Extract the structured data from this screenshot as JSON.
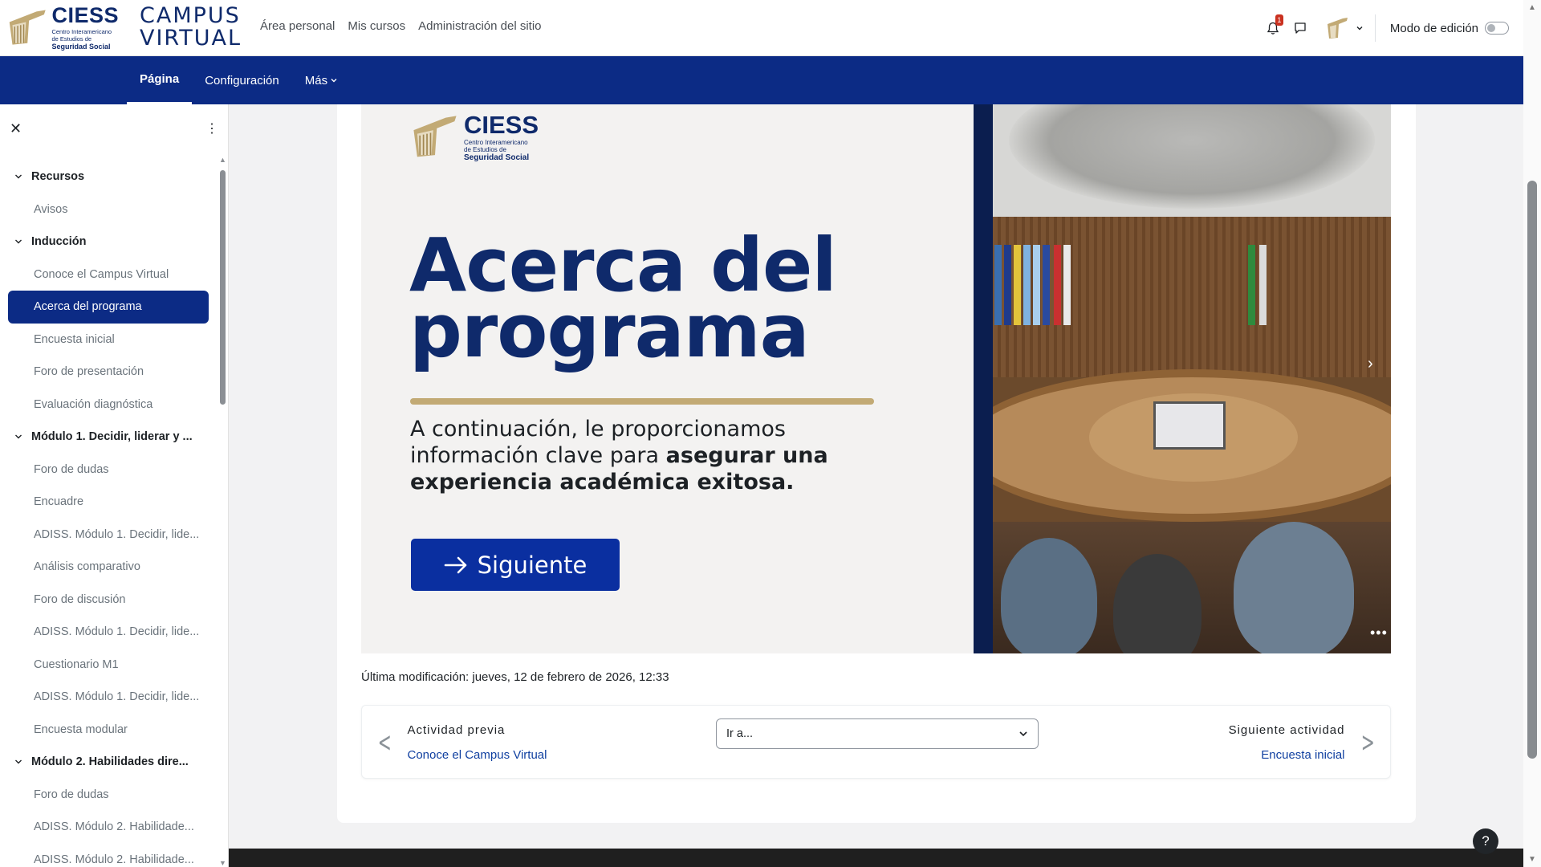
{
  "header": {
    "logo": {
      "name": "CIESS",
      "line1": "Centro Interamericano",
      "line2": "de Estudios de",
      "line3": "Seguridad Social"
    },
    "campus_line1": "CAMPUS",
    "campus_line2": "VIRTUAL",
    "nav": [
      "Área personal",
      "Mis cursos",
      "Administración del sitio"
    ],
    "notification_count": "1",
    "edit_mode_label": "Modo de edición",
    "edit_mode_on": false
  },
  "secondary_nav": {
    "tabs": [
      "Página",
      "Configuración",
      "Más"
    ],
    "active": "Página"
  },
  "drawer": {
    "items": [
      {
        "type": "section",
        "label": "Recursos"
      },
      {
        "type": "item",
        "label": "Avisos"
      },
      {
        "type": "section",
        "label": "Inducción"
      },
      {
        "type": "item",
        "label": "Conoce el Campus Virtual"
      },
      {
        "type": "item",
        "label": "Acerca del programa",
        "active": true
      },
      {
        "type": "item",
        "label": "Encuesta inicial"
      },
      {
        "type": "item",
        "label": "Foro de presentación"
      },
      {
        "type": "item",
        "label": "Evaluación diagnóstica"
      },
      {
        "type": "section",
        "label": "Módulo 1. Decidir, liderar y ..."
      },
      {
        "type": "item",
        "label": "Foro de dudas"
      },
      {
        "type": "item",
        "label": "Encuadre"
      },
      {
        "type": "item",
        "label": "ADISS. Módulo 1. Decidir, lide..."
      },
      {
        "type": "item",
        "label": "Análisis comparativo"
      },
      {
        "type": "item",
        "label": "Foro de discusión"
      },
      {
        "type": "item",
        "label": "ADISS. Módulo 1. Decidir, lide..."
      },
      {
        "type": "item",
        "label": "Cuestionario M1"
      },
      {
        "type": "item",
        "label": "ADISS. Módulo 1. Decidir, lide..."
      },
      {
        "type": "item",
        "label": "Encuesta modular"
      },
      {
        "type": "section",
        "label": "Módulo 2. Habilidades dire..."
      },
      {
        "type": "item",
        "label": "Foro de dudas"
      },
      {
        "type": "item",
        "label": "ADISS. Módulo 2. Habilidade..."
      },
      {
        "type": "item",
        "label": "ADISS. Módulo 2. Habilidade..."
      }
    ]
  },
  "banner": {
    "logo": {
      "name": "CIESS",
      "line1": "Centro Interamericano",
      "line2": "de Estudios de",
      "line3": "Seguridad Social"
    },
    "title_line1": "Acerca del",
    "title_line2": "programa",
    "text_part1": "A continuación, le proporcionamos información clave para ",
    "text_bold": "asegurar una experiencia académica exitosa.",
    "button_label": "Siguiente"
  },
  "modified": "Última modificación: jueves, 12 de febrero de 2026, 12:33",
  "activity_nav": {
    "prev_label": "Actividad previa",
    "prev_link": "Conoce el Campus Virtual",
    "jump_label": "Ir a...",
    "next_label": "Siguiente actividad",
    "next_link": "Encuesta inicial"
  },
  "help_label": "?",
  "colors": {
    "brand_navy": "#0c2b85",
    "accent_gold": "#c2aa75",
    "button_blue": "#0a2fa0"
  }
}
